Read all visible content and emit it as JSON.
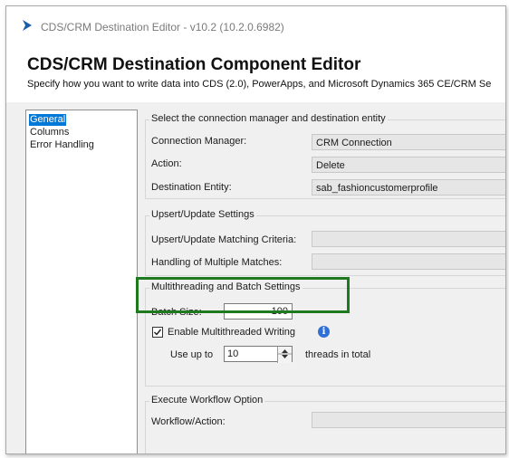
{
  "window": {
    "title": "CDS/CRM Destination Editor - v10.2 (10.2.0.6982)"
  },
  "header": {
    "title": "CDS/CRM Destination Component Editor",
    "subtitle": "Specify how you want to write data into CDS (2.0), PowerApps, and Microsoft Dynamics 365 CE/CRM Se"
  },
  "nav": {
    "items": [
      {
        "label": "General",
        "selected": true
      },
      {
        "label": "Columns",
        "selected": false
      },
      {
        "label": "Error Handling",
        "selected": false
      }
    ]
  },
  "connection_group": {
    "title": "Select the connection manager and destination entity",
    "connection_manager_label": "Connection Manager:",
    "connection_manager_value": "CRM Connection",
    "action_label": "Action:",
    "action_value": "Delete",
    "destination_entity_label": "Destination Entity:",
    "destination_entity_value": "sab_fashioncustomerprofile"
  },
  "upsert_group": {
    "title": "Upsert/Update Settings",
    "matching_criteria_label": "Upsert/Update Matching Criteria:",
    "multiple_matches_label": "Handling of Multiple Matches:"
  },
  "batch_group": {
    "title": "Multithreading and Batch Settings",
    "batch_size_label": "Batch Size:",
    "batch_size_value": "100",
    "enable_multithreaded_label": "Enable Multithreaded Writing",
    "enable_multithreaded_checked": true,
    "use_up_to_label": "Use up to",
    "threads_value": "10",
    "threads_suffix": "threads in total"
  },
  "workflow_group": {
    "title": "Execute Workflow Option",
    "workflow_action_label": "Workflow/Action:"
  },
  "colors": {
    "selection": "#0078d7",
    "highlight_border": "#1f7a1f",
    "info_icon": "#2f6fd6",
    "app_icon": "#1a5ea8"
  }
}
